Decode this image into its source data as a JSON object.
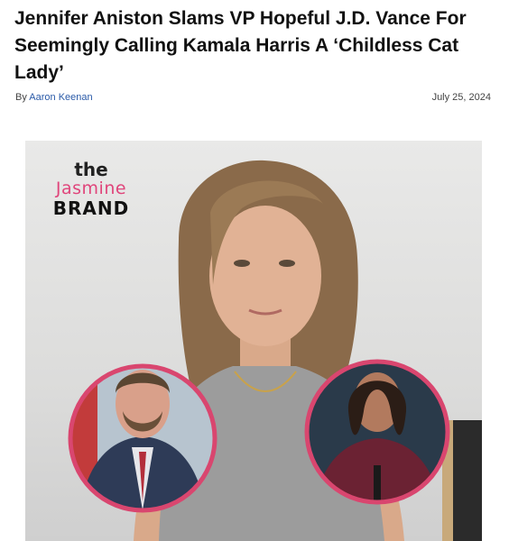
{
  "article": {
    "headline": "Jennifer Aniston Slams VP Hopeful J.D. Vance For Seemingly Calling Kamala Harris A ‘Childless Cat Lady’",
    "byline_prefix": "By",
    "author": "Aaron Keenan",
    "date": "July 25, 2024"
  },
  "image": {
    "logo": {
      "line1": "the",
      "line2": "Jasmine",
      "line3": "BRAND"
    },
    "accent_color": "#d9466f"
  }
}
